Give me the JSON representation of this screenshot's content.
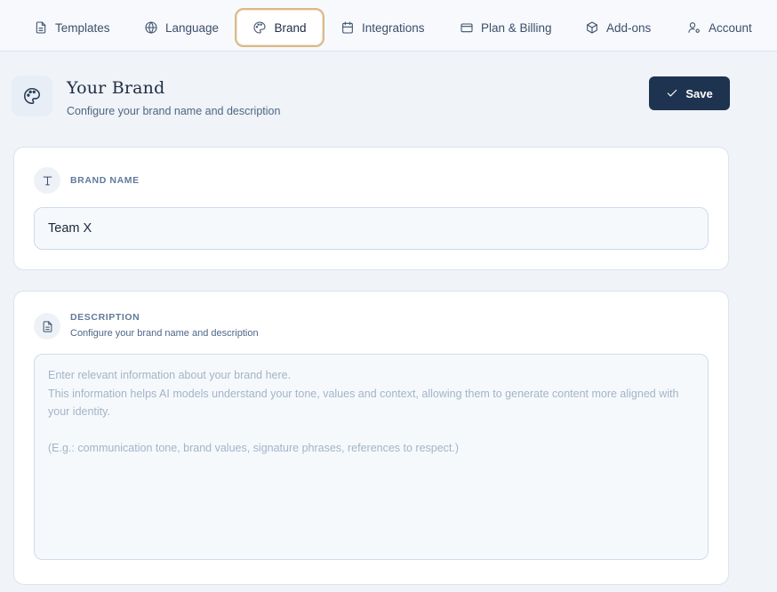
{
  "tabs": [
    {
      "label": "Templates",
      "icon": "file-text-icon"
    },
    {
      "label": "Language",
      "icon": "globe-icon"
    },
    {
      "label": "Brand",
      "icon": "palette-icon",
      "active": true
    },
    {
      "label": "Integrations",
      "icon": "calendar-icon"
    },
    {
      "label": "Plan & Billing",
      "icon": "credit-card-icon"
    },
    {
      "label": "Add-ons",
      "icon": "package-icon"
    },
    {
      "label": "Account",
      "icon": "user-cog-icon"
    }
  ],
  "header": {
    "icon": "palette-icon",
    "title": "Your Brand",
    "subtitle": "Configure your brand name and description",
    "save_label": "Save"
  },
  "brand_name": {
    "icon": "type-icon",
    "label": "BRAND NAME",
    "value": "Team X"
  },
  "description": {
    "icon": "document-icon",
    "label": "DESCRIPTION",
    "subtitle": "Configure your brand name and description",
    "value": "",
    "placeholder": "Enter relevant information about your brand here.\nThis information helps AI models understand your tone, values and context, allowing them to generate content more aligned with your identity.\n\n(E.g.: communication tone, brand values, signature phrases, references to respect.)"
  },
  "colors": {
    "accent_border": "#d9b989",
    "primary_button": "#1e3350",
    "background": "#f0f3f7"
  }
}
